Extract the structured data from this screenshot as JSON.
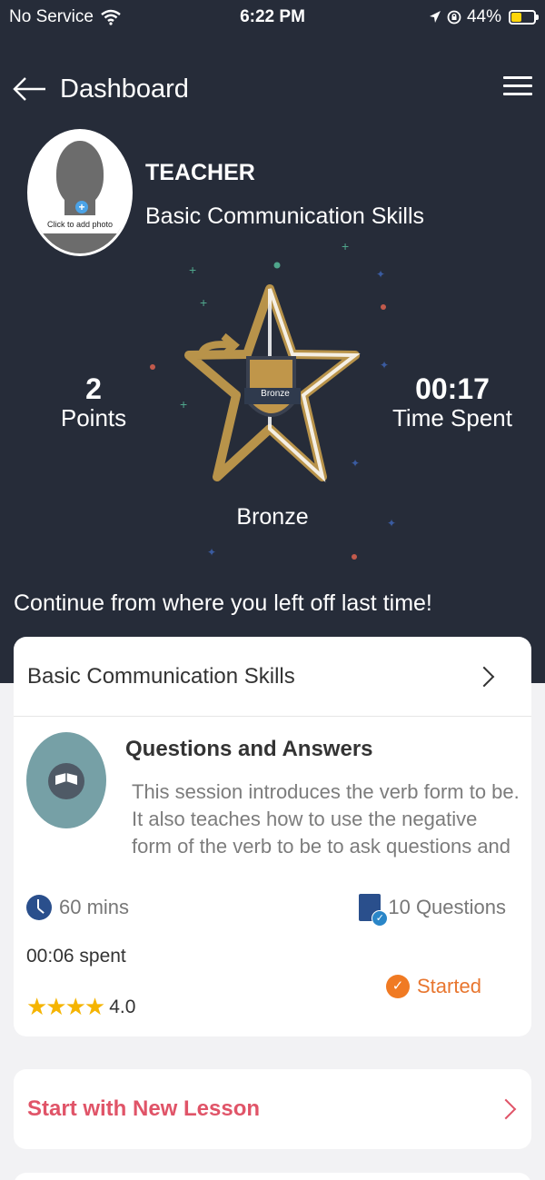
{
  "status_bar": {
    "carrier": "No Service",
    "time": "6:22 PM",
    "battery": "44%",
    "battery_level": 0.44,
    "accent_battery": "#ffd60a"
  },
  "nav": {
    "title": "Dashboard",
    "back_icon": "arrow-left-icon",
    "menu_icon": "hamburger-menu-icon"
  },
  "profile": {
    "avatar_label": "Click to add photo",
    "role": "TEACHER",
    "course": "Basic Communication Skills"
  },
  "stats": {
    "points_value": "2",
    "points_label": "Points",
    "time_value": "00:17",
    "time_label": "Time Spent",
    "badge_text": "Bronze",
    "level_label": "Bronze"
  },
  "continue": {
    "heading": "Continue from where you left off last time!",
    "card_title": "Basic Communication Skills",
    "lesson_title": "Questions and Answers",
    "lesson_description": "This session introduces the verb form to be. It also teaches how to use the negative form of the verb to be to ask questions and how",
    "duration": "60 mins",
    "questions": "10 Questions",
    "spent": "00:06 spent",
    "status": "Started",
    "rating": "4.0",
    "rating_stars": 4
  },
  "new_lesson": {
    "label": "Start with New Lesson"
  },
  "colors": {
    "header_bg": "#262c39",
    "accent_red": "#e05468",
    "accent_orange": "#e8762f",
    "star_gold": "#b8934a"
  }
}
